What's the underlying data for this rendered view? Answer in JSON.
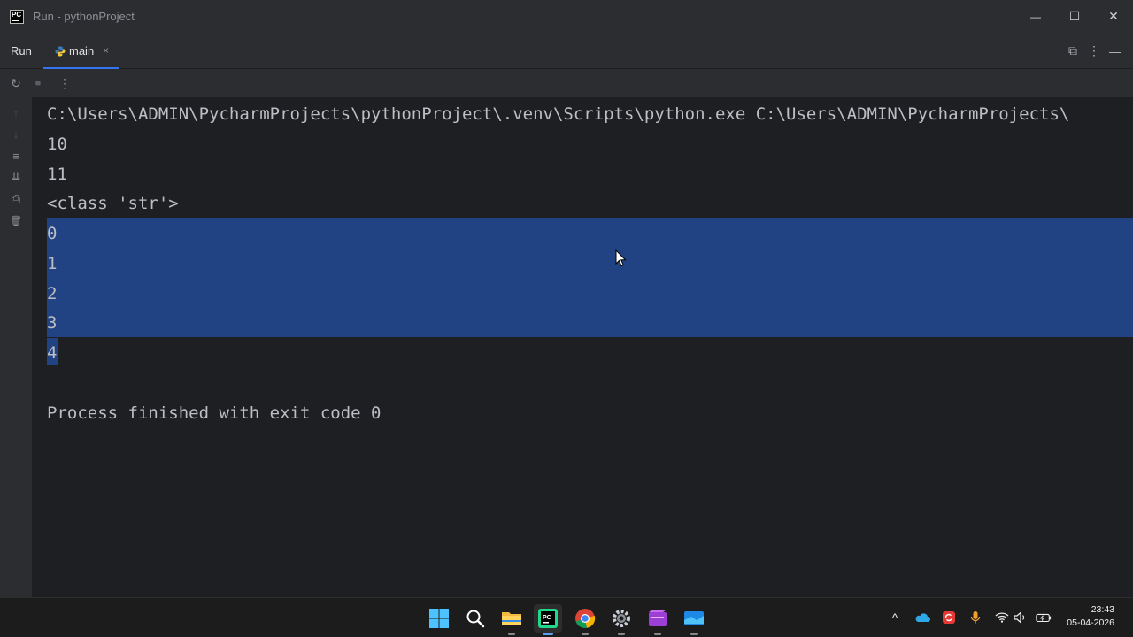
{
  "window": {
    "title": "Run - pythonProject",
    "minimize_glyph": "—",
    "maximize_glyph": "☐",
    "close_glyph": "✕"
  },
  "run_panel": {
    "label": "Run",
    "tab": {
      "label": "main",
      "close_glyph": "×",
      "icon": "python-icon"
    },
    "header_actions": [
      {
        "name": "layout-icon",
        "glyph": "⧉"
      },
      {
        "name": "more-options-icon",
        "glyph": "⋮"
      },
      {
        "name": "hide-panel-icon",
        "glyph": "—"
      }
    ],
    "toolbar": [
      {
        "name": "rerun-icon",
        "glyph": "↻"
      },
      {
        "name": "stop-icon",
        "glyph": "■"
      },
      {
        "name": "more-icon",
        "glyph": "⋮"
      }
    ],
    "side_actions": [
      {
        "name": "scroll-up-icon",
        "glyph": "↑",
        "enabled": false
      },
      {
        "name": "scroll-down-icon",
        "glyph": "↓",
        "enabled": false
      },
      {
        "name": "soft-wrap-icon",
        "glyph": "≡",
        "enabled": true
      },
      {
        "name": "scroll-to-end-icon",
        "glyph": "⇊",
        "enabled": true
      },
      {
        "name": "print-icon",
        "glyph": "⎙",
        "enabled": true
      },
      {
        "name": "clear-all-icon",
        "glyph": "🗑",
        "enabled": true
      }
    ]
  },
  "console": {
    "lines": [
      "C:\\Users\\ADMIN\\PycharmProjects\\pythonProject\\.venv\\Scripts\\python.exe C:\\Users\\ADMIN\\PycharmProjects\\",
      "10",
      "11",
      "<class 'str'>",
      "0",
      "1",
      "2",
      "3",
      "4",
      "",
      "Process finished with exit code 0"
    ],
    "selection_color": "#214283"
  },
  "taskbar": {
    "apps": [
      {
        "name": "windows-start-icon",
        "active": false
      },
      {
        "name": "search-icon",
        "active": false
      },
      {
        "name": "file-explorer-icon",
        "active": false
      },
      {
        "name": "pycharm-icon",
        "active": true
      },
      {
        "name": "chrome-icon",
        "active": false
      },
      {
        "name": "settings-icon",
        "active": false
      },
      {
        "name": "video-editor-icon",
        "active": false
      },
      {
        "name": "app-icon",
        "active": false
      }
    ],
    "tray": {
      "chevron_glyph": "^",
      "time": "23:43",
      "date": "05-04-2026"
    }
  },
  "colors": {
    "accent": "#3574f0",
    "background": "#1e1f22",
    "panel": "#2b2d30",
    "text": "#bcbec4"
  }
}
